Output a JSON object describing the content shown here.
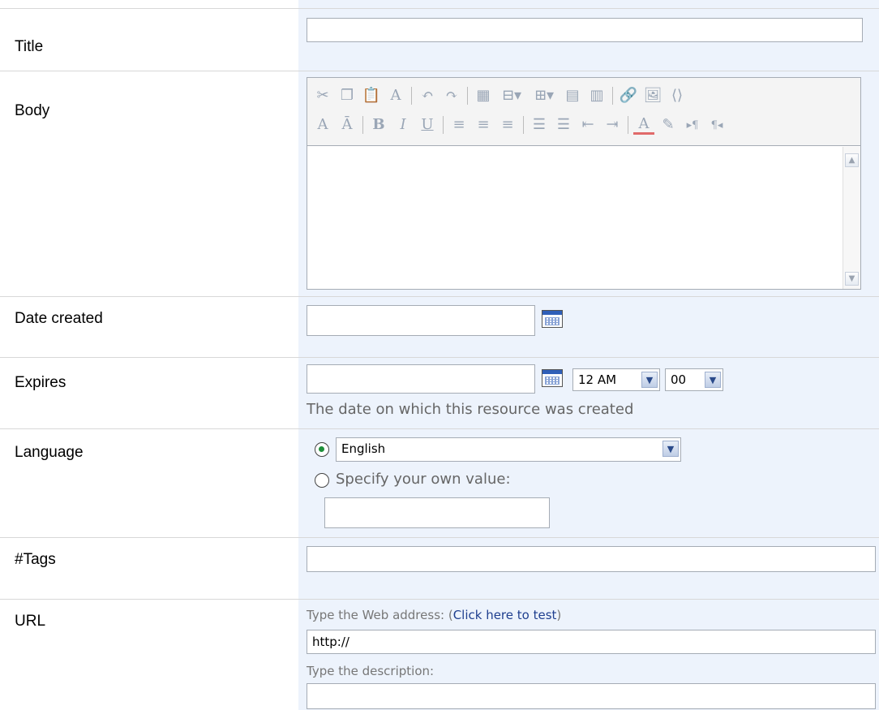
{
  "fields": {
    "title": {
      "label": "Title",
      "value": ""
    },
    "body": {
      "label": "Body",
      "toolbar_row1_icons": [
        "cut-icon",
        "copy-icon",
        "paste-icon",
        "spellcheck-icon",
        "undo-icon",
        "redo-icon",
        "insert-table-icon",
        "insert-column-left-icon",
        "insert-column-right-icon",
        "merge-cells-icon",
        "split-cells-icon",
        "insert-hyperlink-icon",
        "insert-image-icon",
        "html-source-icon"
      ],
      "toolbar_row2_icons": [
        "font-size-icon",
        "font-size-alt-icon",
        "bold-icon",
        "italic-icon",
        "underline-icon",
        "align-left-icon",
        "align-center-icon",
        "align-right-icon",
        "numbered-list-icon",
        "bulleted-list-icon",
        "decrease-indent-icon",
        "increase-indent-icon",
        "text-color-icon",
        "highlight-color-icon",
        "ltr-icon",
        "rtl-icon"
      ],
      "value": ""
    },
    "date_created": {
      "label": "Date created",
      "value": ""
    },
    "expires": {
      "label": "Expires",
      "value": "",
      "hour": "12 AM",
      "minute": "00",
      "hint": "The date on which this resource was created"
    },
    "language": {
      "label": "Language",
      "selected_option": "English",
      "own_value_label": "Specify your own value:",
      "own_value": ""
    },
    "tags": {
      "label": "#Tags",
      "value": ""
    },
    "url": {
      "label": "URL",
      "address_hint": "Type the Web address: (",
      "test_link": "Click here to test",
      "address_hint_end": ")",
      "address_value": "http://",
      "description_hint": "Type the description:",
      "description_value": ""
    }
  },
  "colors": {
    "field_background": "#edf3fc",
    "border": "#a5acb5",
    "link": "#1f3f8f"
  }
}
